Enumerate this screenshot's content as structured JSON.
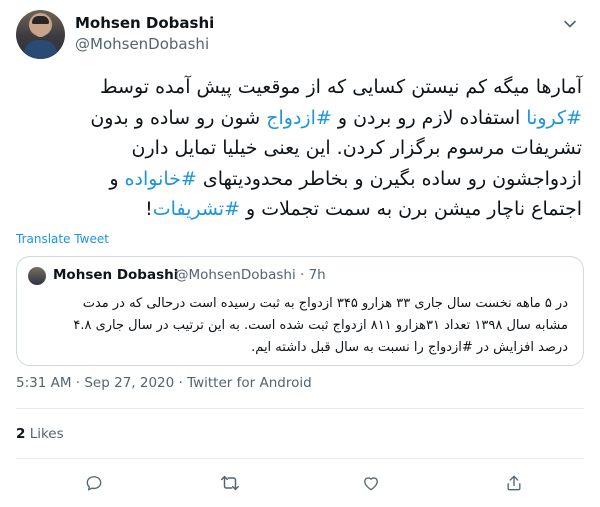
{
  "author": {
    "name": "Mohsen Dobashi",
    "handle": "@MohsenDobashi"
  },
  "tweet": {
    "line1": "آمارها میگه کم نیستن کسایی که از موقعیت پیش آمده توسط",
    "line2_tag1": "#کرونا",
    "line2_mid": " استفاده لازم رو بردن و ",
    "line2_tag2": "#ازدواج",
    "line2_end": " شون رو ساده و بدون",
    "line3": "تشریفات مرسوم برگزار کردن. این یعنی خیلیا تمایل دارن",
    "line4_start": "ازدواجشون رو ساده بگیرن و بخاطر محدودیتهای ",
    "line4_tag": "#خانواده",
    "line4_end": " و",
    "line5_start": "اجتماع ناچار میشن برن به سمت تجملات و ",
    "line5_tag": "#تشریفات",
    "line5_end": "!"
  },
  "translate_label": "Translate Tweet",
  "quoted": {
    "name": "Mohsen Dobashi",
    "handle_time": "@MohsenDobashi · 7h",
    "line1": "در ۵ ماهه نخست سال جاری ۳۳ هزارو ۳۴۵ ازدواج به ثبت رسیده است درحالی که در مدت",
    "line2": "مشابه سال ۱۳۹۸ تعداد ۳۱هزارو ۸۱۱ ازدواج ثبت شده است. به این ترتیب در سال جاری ۴.۸",
    "line3": "درصد افزایش در #ازدواج را نسبت به سال قبل داشته ایم."
  },
  "timestamp": "5:31 AM · Sep 27, 2020 · Twitter for Android",
  "likes": {
    "count": "2",
    "label": "Likes"
  },
  "icons": {
    "more": "chevron-down-icon",
    "reply": "reply-icon",
    "retweet": "retweet-icon",
    "like": "heart-icon",
    "share": "share-icon"
  },
  "colors": {
    "accent": "#1b95e0",
    "muted": "#536471",
    "border": "#cfd9de"
  }
}
